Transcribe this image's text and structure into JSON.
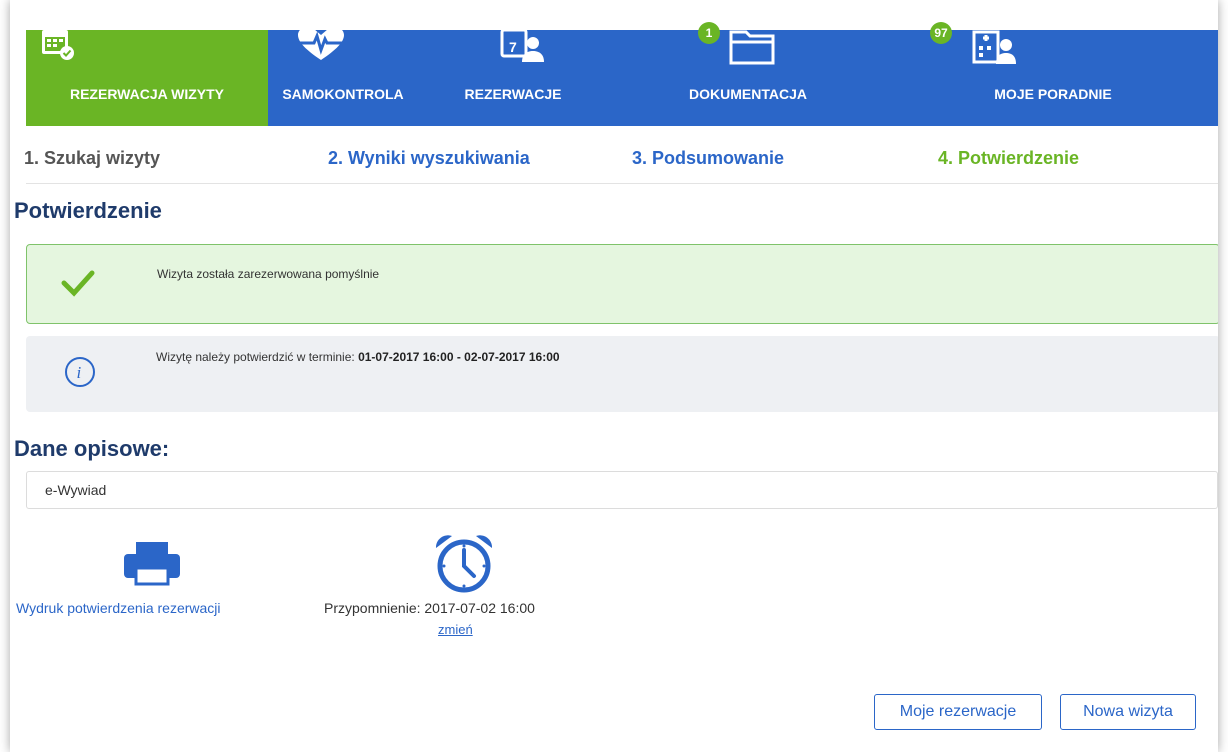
{
  "nav": {
    "tabs": [
      {
        "label": "REZERWACJA WIZYTY",
        "icon": "calendar-check-icon",
        "active": true
      },
      {
        "label": "SAMOKONTROLA",
        "icon": "heart-pulse-icon"
      },
      {
        "label": "REZERWACJE",
        "icon": "calendar-person-icon"
      },
      {
        "label": "DOKUMENTACJA",
        "icon": "folder-icon",
        "badge": "1"
      },
      {
        "label": "MOJE PORADNIE",
        "icon": "clinic-person-icon",
        "badge": "97"
      }
    ]
  },
  "steps": [
    {
      "label": "1. Szukaj wizyty",
      "state": "done"
    },
    {
      "label": "2. Wyniki wyszukiwania",
      "state": "link"
    },
    {
      "label": "3. Podsumowanie",
      "state": "link"
    },
    {
      "label": "4. Potwierdzenie",
      "state": "current"
    }
  ],
  "page_title": "Potwierdzenie",
  "success_message": "Wizyta została zarezerwowana pomyślnie",
  "info": {
    "text": "Wizytę należy potwierdzić w terminie:",
    "range": "01-07-2017 16:00 - 02-07-2017 16:00"
  },
  "desc_title": "Dane opisowe:",
  "desc_value": "e-Wywiad",
  "print_label": "Wydruk potwierdzenia rezerwacji",
  "reminder": {
    "text": "Przypomnienie: 2017-07-02 16:00",
    "change": "zmień"
  },
  "buttons": {
    "my_reservations": "Moje rezerwacje",
    "new_visit": "Nowa wizyta"
  },
  "colors": {
    "nav_blue": "#2b66c8",
    "active_green": "#6ab525",
    "title_navy": "#1f3b6b",
    "success_bg": "#e5f6df",
    "info_bg": "#eef0f3"
  }
}
